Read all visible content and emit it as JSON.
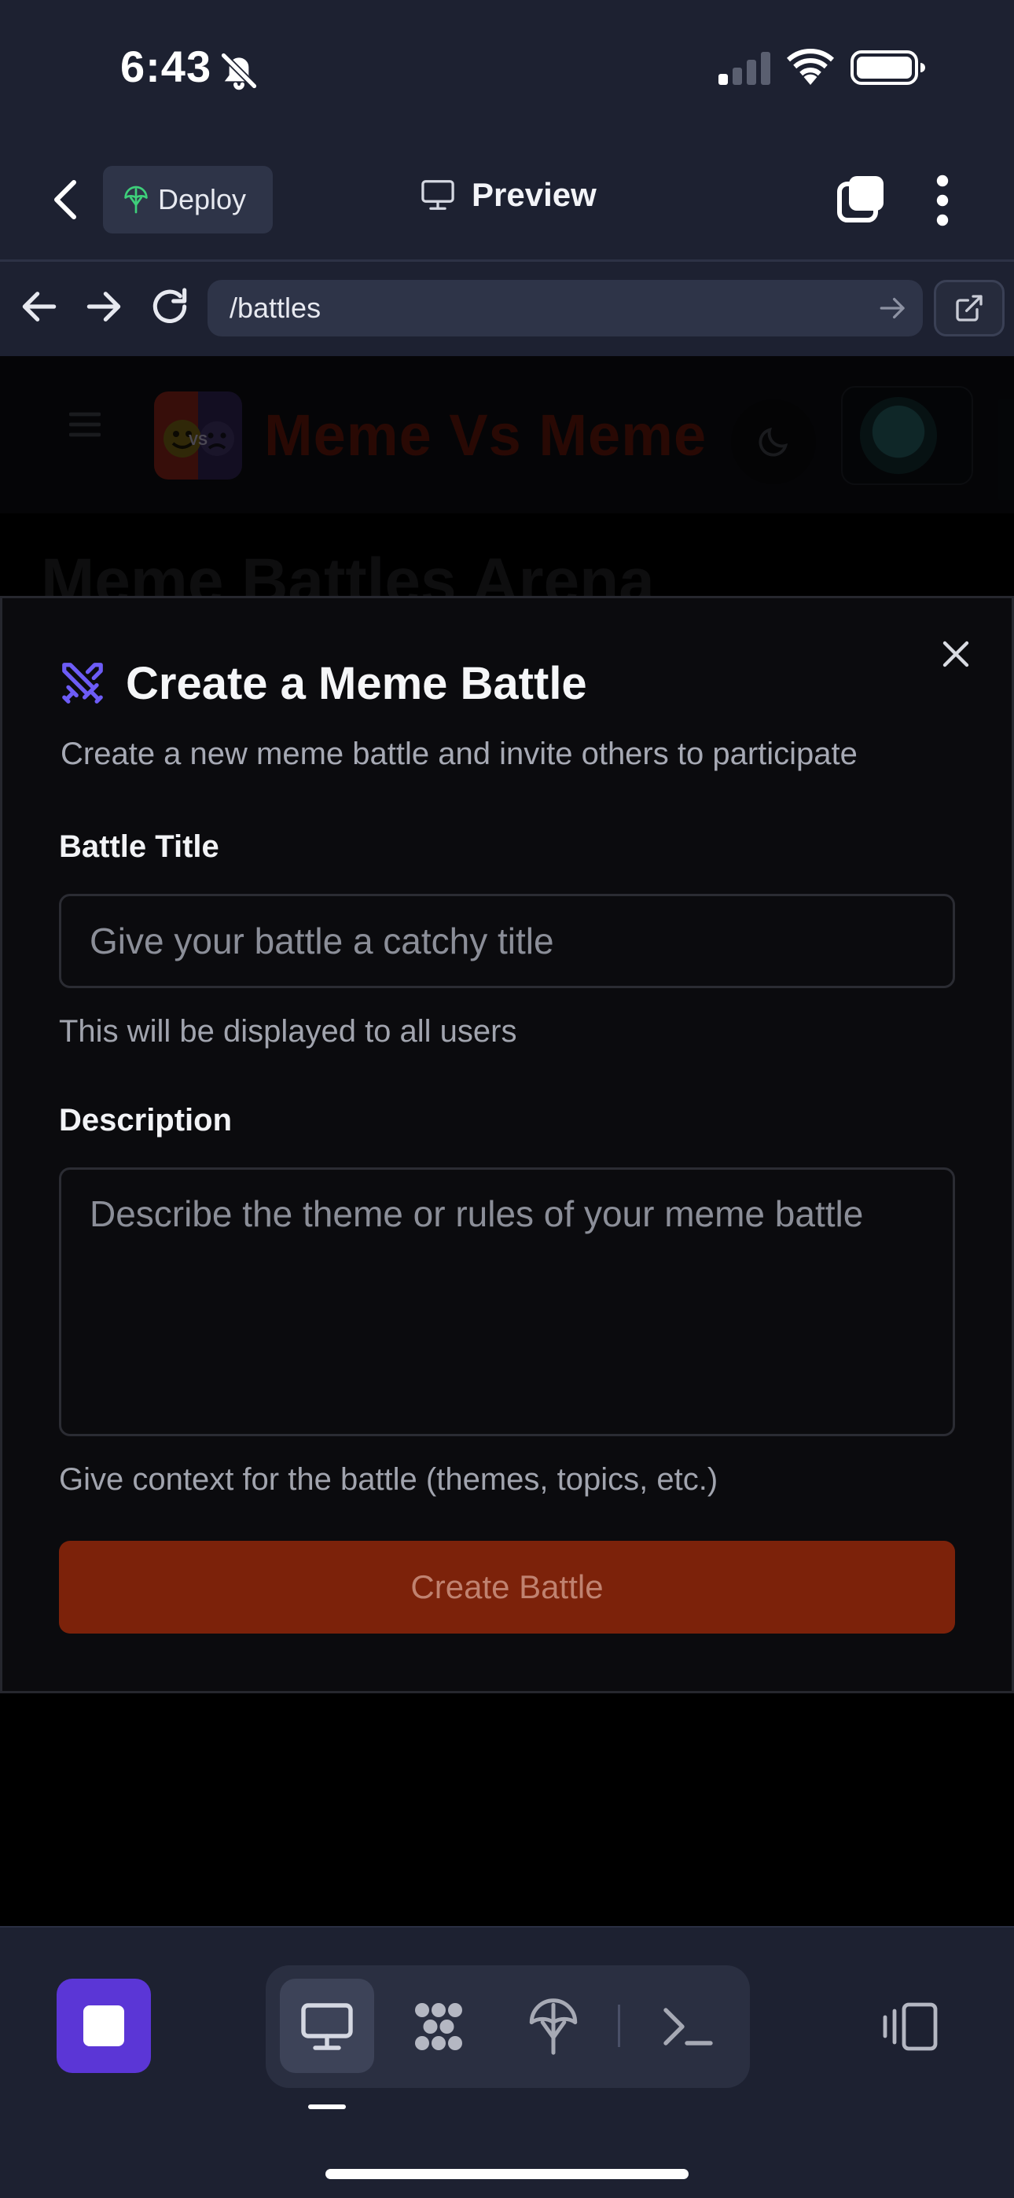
{
  "status_bar": {
    "time": "6:43",
    "icons": [
      "bell-slash-icon",
      "cellular-signal-icon",
      "wifi-icon",
      "battery-icon"
    ]
  },
  "app_bar": {
    "deploy_label": "Deploy",
    "preview_label": "Preview",
    "icons": [
      "back-chevron-icon",
      "deploy-icon",
      "monitor-icon",
      "tabs-icon",
      "more-vertical-icon"
    ]
  },
  "browser": {
    "url": "/battles",
    "icons": [
      "arrow-left-icon",
      "arrow-right-icon",
      "reload-icon",
      "go-arrow-icon",
      "open-external-icon"
    ]
  },
  "site": {
    "title": "Meme Vs Meme",
    "page_heading": "Meme Battles Arena"
  },
  "modal": {
    "title": "Create a Meme Battle",
    "description": "Create a new meme battle and invite others to participate",
    "battle_title_label": "Battle Title",
    "battle_title_placeholder": "Give your battle a catchy title",
    "battle_title_value": "",
    "battle_title_helper": "This will be displayed to all users",
    "description_label": "Description",
    "description_placeholder": "Describe the theme or rules of your meme battle",
    "description_value": "",
    "description_helper": "Give context for the battle (themes, topics, etc.)",
    "submit_label": "Create Battle"
  },
  "bottom_bar": {
    "tools": [
      "monitor-icon",
      "apps-grid-icon",
      "deploy-icon",
      "terminal-icon"
    ],
    "active_tool": "monitor-icon"
  },
  "colors": {
    "app_background": "#1d2131",
    "accent_purple": "#5b36d6",
    "create_button": "#7c220a",
    "modal_background": "#0b0b0e"
  }
}
